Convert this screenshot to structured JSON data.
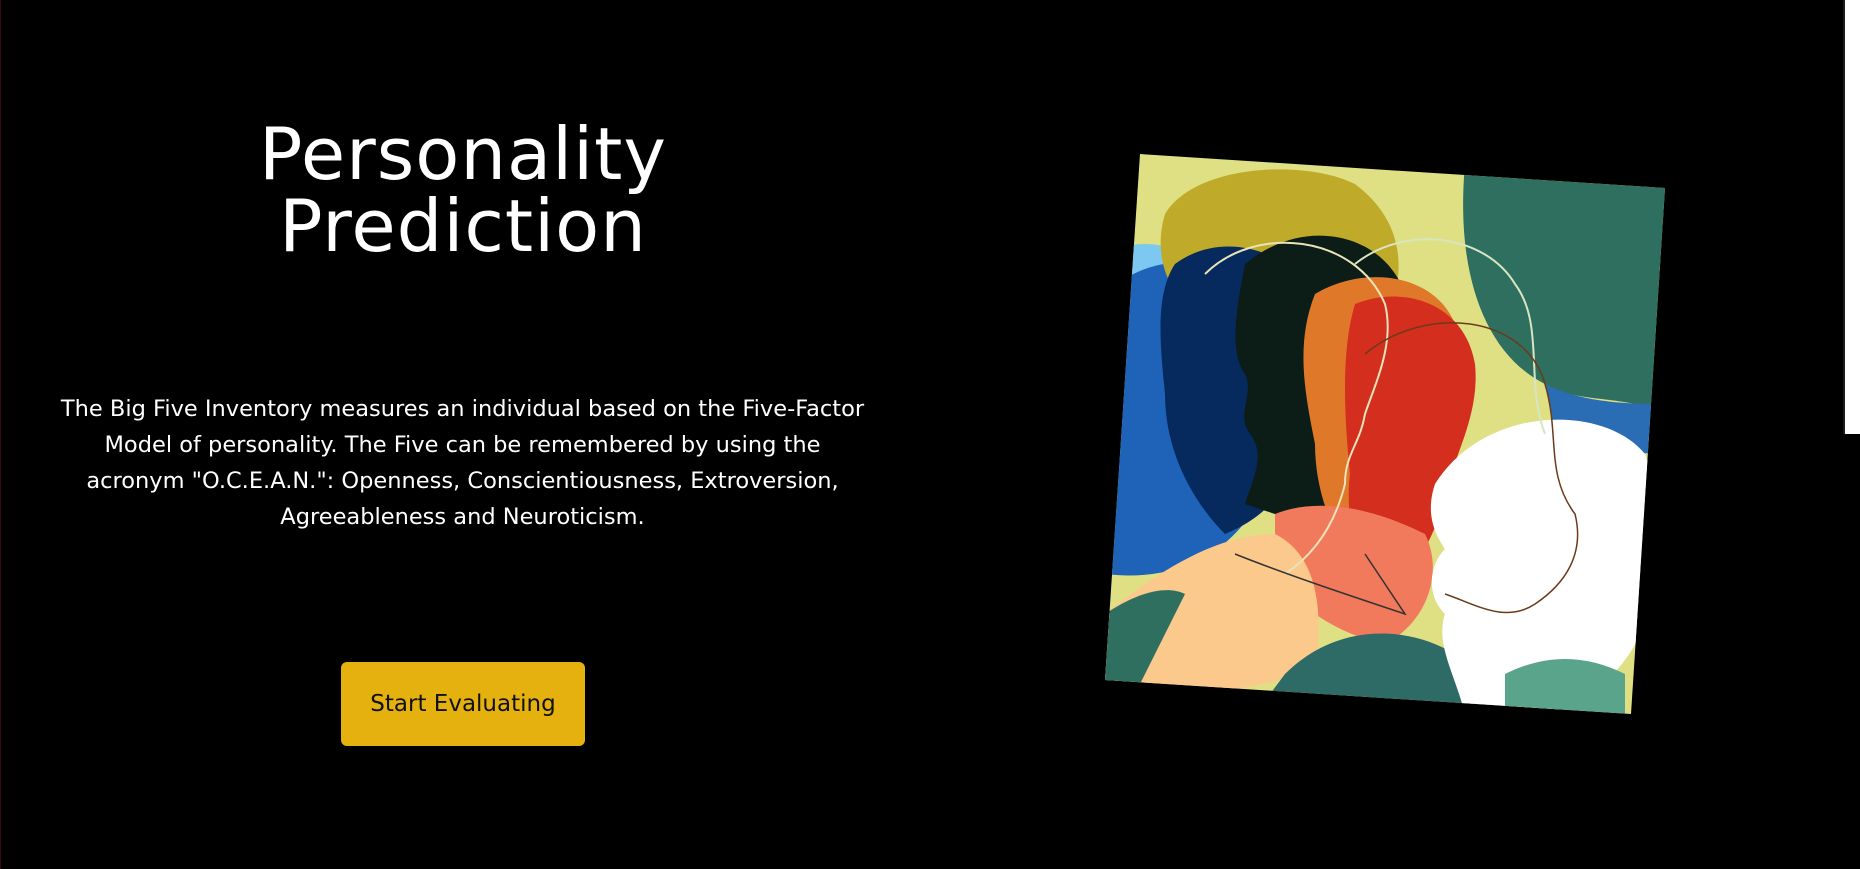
{
  "hero": {
    "title_line_1": "Personality",
    "title_line_2": "Prediction",
    "description": "The Big Five Inventory measures an individual based on the Five-Factor Model of personality. The Five can be remembered by using the acronym \"O.C.E.A.N.\": Openness, Conscientiousness, Extroversion, Agreeableness and Neuroticism.",
    "cta_label": "Start Evaluating"
  },
  "colors": {
    "background": "#000000",
    "text": "#ffffff",
    "cta_background": "#e5b10f",
    "cta_text": "#111111"
  },
  "illustration": {
    "icon": "overlapping-head-silhouettes"
  }
}
